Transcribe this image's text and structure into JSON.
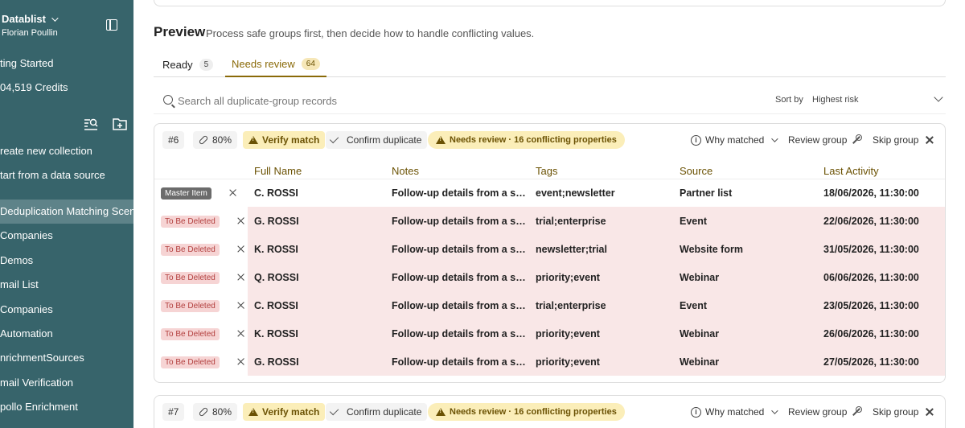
{
  "sidebar": {
    "workspace": "Datablist",
    "user": "Florian Poullin",
    "getting_started": "ting Started",
    "credits": "04,519 Credits",
    "create_collection": "reate new collection",
    "start_from_source": "tart from a data source",
    "items": [
      {
        "label": "Deduplication Matching Scenar",
        "active": true
      },
      {
        "label": "Companies"
      },
      {
        "label": "Demos"
      },
      {
        "label": "mail List"
      },
      {
        "label": "Companies"
      },
      {
        "label": "Automation"
      },
      {
        "label": "nrichmentSources"
      },
      {
        "label": "mail Verification"
      },
      {
        "label": "pollo Enrichment"
      }
    ]
  },
  "preview": {
    "title": "Preview",
    "subtitle": "Process safe groups first, then decide how to handle conflicting values."
  },
  "tabs": [
    {
      "label": "Ready",
      "count": "5"
    },
    {
      "label": "Needs review",
      "count": "64",
      "active": true
    }
  ],
  "search": {
    "placeholder": "Search all duplicate-group records"
  },
  "sort": {
    "label": "Sort by",
    "value": "Highest risk"
  },
  "groups": [
    {
      "id": "#6",
      "score": "80%",
      "verify_label": "Verify match",
      "confirm_label": "Confirm duplicate",
      "review_label": "Needs review · 16 conflicting properties",
      "why_label": "Why matched",
      "review_group_label": "Review group",
      "skip_label": "Skip group",
      "columns": [
        "Full Name",
        "Notes",
        "Tags",
        "Source",
        "Last Activity"
      ],
      "rows": [
        {
          "status": "Master Item",
          "name": "C. ROSSI",
          "notes": "Follow-up details from a sec...",
          "tags": "event;newsletter",
          "source": "Partner list",
          "activity": "18/06/2026, 11:30:00"
        },
        {
          "status": "To Be Deleted",
          "name": "G. ROSSI",
          "notes": "Follow-up details from a sec...",
          "tags": "trial;enterprise",
          "source": "Event",
          "activity": "22/06/2026, 11:30:00"
        },
        {
          "status": "To Be Deleted",
          "name": "K. ROSSI",
          "notes": "Follow-up details from a sec...",
          "tags": "newsletter;trial",
          "source": "Website form",
          "activity": "31/05/2026, 11:30:00"
        },
        {
          "status": "To Be Deleted",
          "name": "Q. ROSSI",
          "notes": "Follow-up details from a sec...",
          "tags": "priority;event",
          "source": "Webinar",
          "activity": "06/06/2026, 11:30:00"
        },
        {
          "status": "To Be Deleted",
          "name": "C. ROSSI",
          "notes": "Follow-up details from a sec...",
          "tags": "trial;enterprise",
          "source": "Event",
          "activity": "23/05/2026, 11:30:00"
        },
        {
          "status": "To Be Deleted",
          "name": "K. ROSSI",
          "notes": "Follow-up details from a sec...",
          "tags": "priority;event",
          "source": "Webinar",
          "activity": "26/06/2026, 11:30:00"
        },
        {
          "status": "To Be Deleted",
          "name": "G. ROSSI",
          "notes": "Follow-up details from a sec...",
          "tags": "priority;event",
          "source": "Webinar",
          "activity": "27/05/2026, 11:30:00"
        }
      ]
    },
    {
      "id": "#7",
      "score": "80%",
      "verify_label": "Verify match",
      "confirm_label": "Confirm duplicate",
      "review_label": "Needs review · 16 conflicting properties",
      "why_label": "Why matched",
      "review_group_label": "Review group",
      "skip_label": "Skip group"
    }
  ],
  "colors": {
    "sidebar": "#37646b",
    "sidebar_active": "#5e8389",
    "accent": "#8a6a08",
    "warn_bg": "#fbeeb9",
    "delete_row": "#f9e7e7"
  }
}
